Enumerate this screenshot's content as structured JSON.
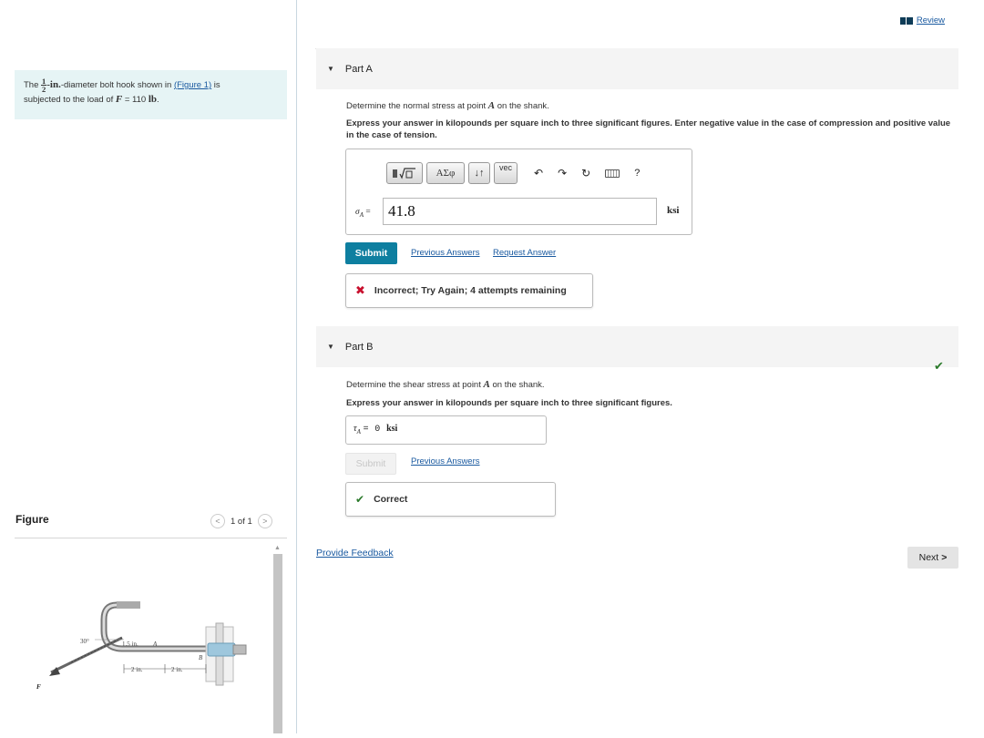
{
  "problem": {
    "text_before": "The",
    "frac_num": "1",
    "frac_den": "2",
    "text_unit": "-in.",
    "text_mid": "-diameter bolt hook shown in",
    "figure_link": "(Figure 1)",
    "text_is": "is",
    "text_line2": "subjected to the load of",
    "load_symbol": "F",
    "load_value": "= 110",
    "load_unit": "lb",
    "load_end": "."
  },
  "figure": {
    "title": "Figure",
    "pager": "1 of 1",
    "labels": {
      "angle": "30°",
      "dim_15": "1.5 in.",
      "point_a": "A",
      "dim_2a": "2 in.",
      "dim_2b": "2 in.",
      "point_b": "B",
      "force": "F"
    }
  },
  "header": {
    "review": "Review"
  },
  "partA": {
    "title": "Part A",
    "question": "Determine the normal stress at point",
    "question_point": "A",
    "question_end": "on the shank.",
    "instruction": "Express your answer in kilopounds per square inch to three significant figures. Enter negative value in the case of compression and positive value in the case of tension.",
    "toolbar": [
      "ΑΣφ",
      "↓↑",
      "vec",
      "?"
    ],
    "label": "σ",
    "label_sub": "A",
    "label_eq": "=",
    "value": "41.8",
    "unit": "ksi",
    "submit": "Submit",
    "previous": "Previous Answers",
    "request": "Request Answer",
    "feedback": "Incorrect; Try Again; 4 attempts remaining"
  },
  "partB": {
    "title": "Part B",
    "question": "Determine the shear stress at point",
    "question_point": "A",
    "question_end": "on the shank.",
    "instruction": "Express your answer in kilopounds per square inch to three significant figures.",
    "label": "τ",
    "label_sub": "A",
    "label_eq": "=",
    "value": "0",
    "unit": "ksi",
    "submit": "Submit",
    "previous": "Previous Answers",
    "feedback": "Correct"
  },
  "footer": {
    "provide_feedback": "Provide Feedback",
    "next": "Next"
  },
  "colors": {
    "accent": "#0e7fa0",
    "link": "#1a5aa0",
    "error": "#c8102e",
    "success": "#2b7a2b",
    "problem_bg": "#e6f4f5"
  }
}
